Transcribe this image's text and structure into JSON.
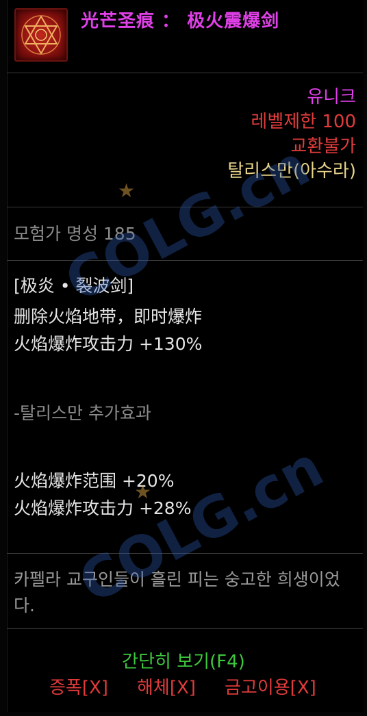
{
  "item": {
    "title": "光芒圣痕 ： 极火震爆剑",
    "icon": "hexagram-seal-icon",
    "rarity": "유니크",
    "level_limit": "레벨제한 100",
    "trade": "교환불가",
    "class": "탈리스만(아수라)",
    "adventure_fame": "모험가 명성 185"
  },
  "skill": {
    "name": "[极炎 • 裂波剑]",
    "desc": "删除火焰地带，即时爆炸",
    "attack": "火焰爆炸攻击力 +130%"
  },
  "talisman": {
    "title": "-탈리스만 추가효과",
    "range": "火焰爆炸范围 +20%",
    "attack": "火焰爆炸攻击力 +28%"
  },
  "flavor": "카펠라 교구인들이 흘린 피는 숭고한 희생이었다.",
  "footer": {
    "quick_view": "간단히 보기(F4)",
    "actions": [
      "증폭[X]",
      "해체[X]",
      "금고이용[X]"
    ]
  },
  "watermark": "COLG.cn",
  "colors": {
    "rarity": "#e040e8",
    "restriction": "#e23b3b",
    "class": "#e8d48a",
    "gray": "#8c8c8c",
    "green": "#3ec83e"
  }
}
